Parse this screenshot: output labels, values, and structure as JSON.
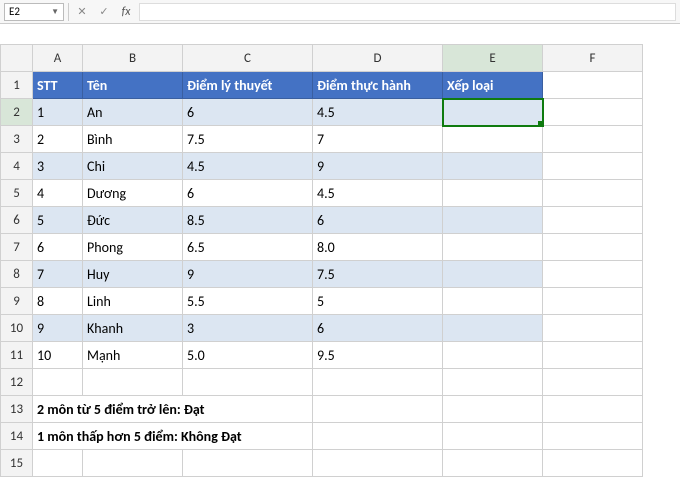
{
  "formula_bar": {
    "name_box": "E2",
    "cancel_glyph": "✕",
    "confirm_glyph": "✓",
    "fx_label": "fx",
    "formula_value": ""
  },
  "columns": [
    "A",
    "B",
    "C",
    "D",
    "E",
    "F"
  ],
  "row_numbers": [
    "1",
    "2",
    "3",
    "4",
    "5",
    "6",
    "7",
    "8",
    "9",
    "10",
    "11",
    "12",
    "13",
    "14",
    "15"
  ],
  "header": {
    "stt": "STT",
    "ten": "Tên",
    "ly_thuyet": "Điểm lý thuyết",
    "thuc_hanh": "Điểm thực hành",
    "xep_loai": "Xếp loại"
  },
  "rows": [
    {
      "stt": "1",
      "ten": "An",
      "ly_thuyet": "6",
      "thuc_hanh": "4.5"
    },
    {
      "stt": "2",
      "ten": "Bình",
      "ly_thuyet": "7.5",
      "thuc_hanh": "7"
    },
    {
      "stt": "3",
      "ten": "Chi",
      "ly_thuyet": "4.5",
      "thuc_hanh": "9"
    },
    {
      "stt": "4",
      "ten": "Dương",
      "ly_thuyet": "6",
      "thuc_hanh": "4.5"
    },
    {
      "stt": "5",
      "ten": "Đức",
      "ly_thuyet": "8.5",
      "thuc_hanh": "6"
    },
    {
      "stt": "6",
      "ten": "Phong",
      "ly_thuyet": "6.5",
      "thuc_hanh": "8.0"
    },
    {
      "stt": "7",
      "ten": "Huy",
      "ly_thuyet": "9",
      "thuc_hanh": "7.5"
    },
    {
      "stt": "8",
      "ten": "Linh",
      "ly_thuyet": "5.5",
      "thuc_hanh": "5"
    },
    {
      "stt": "9",
      "ten": "Khanh",
      "ly_thuyet": "3",
      "thuc_hanh": "6"
    },
    {
      "stt": "10",
      "ten": "Mạnh",
      "ly_thuyet": "5.0",
      "thuc_hanh": "9.5"
    }
  ],
  "notes": {
    "line1": "2 môn từ 5 điểm trở lên: Đạt",
    "line2": "1 môn thấp hơn 5 điểm: Không Đạt"
  },
  "selected_cell": "E2",
  "chart_data": {
    "type": "table",
    "title": "",
    "columns": [
      "STT",
      "Tên",
      "Điểm lý thuyết",
      "Điểm thực hành",
      "Xếp loại"
    ],
    "rows": [
      [
        1,
        "An",
        6,
        4.5,
        null
      ],
      [
        2,
        "Bình",
        7.5,
        7,
        null
      ],
      [
        3,
        "Chi",
        4.5,
        9,
        null
      ],
      [
        4,
        "Dương",
        6,
        4.5,
        null
      ],
      [
        5,
        "Đức",
        8.5,
        6,
        null
      ],
      [
        6,
        "Phong",
        6.5,
        8.0,
        null
      ],
      [
        7,
        "Huy",
        9,
        7.5,
        null
      ],
      [
        8,
        "Linh",
        5.5,
        5,
        null
      ],
      [
        9,
        "Khanh",
        3,
        6,
        null
      ],
      [
        10,
        "Mạnh",
        5.0,
        9.5,
        null
      ]
    ],
    "notes": [
      "2 môn từ 5 điểm trở lên: Đạt",
      "1 môn thấp hơn 5 điểm: Không Đạt"
    ]
  }
}
